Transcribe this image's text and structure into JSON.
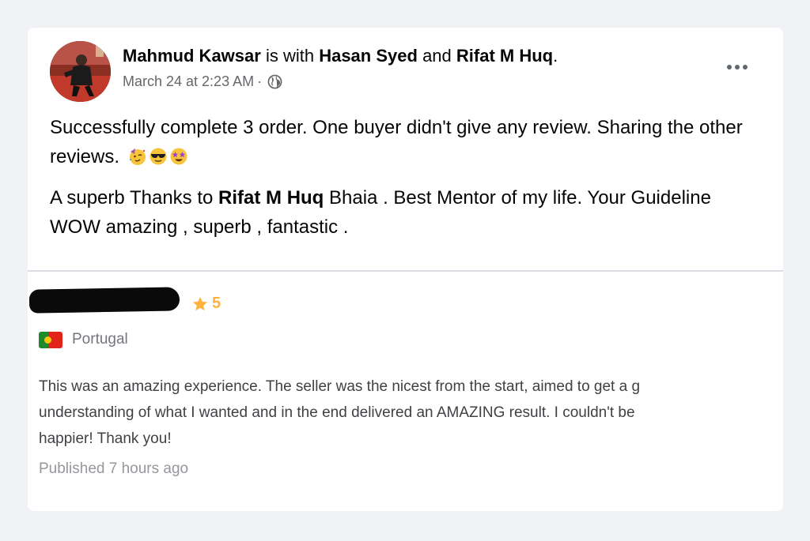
{
  "post": {
    "author": "Mahmud Kawsar",
    "with_text": "is with",
    "tagged_1": "Hasan Syed",
    "and_text": "and",
    "tagged_2": "Rifat M Huq",
    "period": ".",
    "timestamp": "March 24 at 2:23 AM",
    "separator": "·",
    "audience_icon": "globe-icon",
    "more_icon": "more-options-icon",
    "para1_text": "Successfully complete 3 order. One buyer didn't give any review. Sharing the other reviews.",
    "emojis": [
      "partying-face-emoji",
      "sunglasses-face-emoji",
      "star-struck-emoji"
    ],
    "para2_prefix": "A superb Thanks to",
    "para2_mention": "Rifat M Huq",
    "para2_suffix": "Bhaia . Best Mentor of my life. Your Guideline WOW amazing , superb , fantastic ."
  },
  "review": {
    "rating": "5",
    "rating_icon": "star-icon",
    "country": "Portugal",
    "country_flag_icon": "portugal-flag-icon",
    "line1": "This was an amazing experience. The seller was the nicest from the start, aimed to get a g",
    "line2": "understanding of what I wanted and in the end delivered an AMAZING result. I couldn't be",
    "line3": "happier! Thank you!",
    "published": "Published 7 hours ago"
  },
  "colors": {
    "page_bg": "#f0f2f5",
    "card_bg": "#ffffff",
    "secondary_text": "#65676b",
    "star": "#ffb33e",
    "review_text": "#404145"
  }
}
